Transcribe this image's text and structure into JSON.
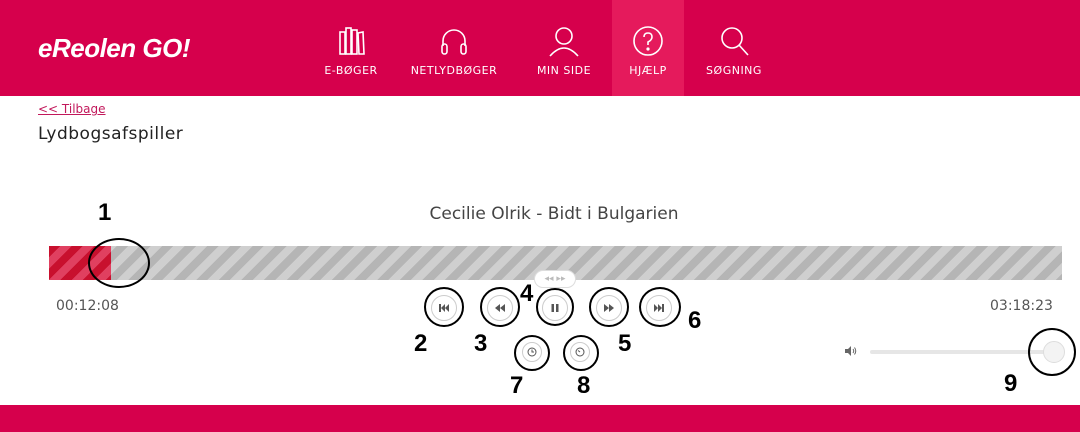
{
  "header": {
    "logo": "eReolen GO!",
    "nav": [
      {
        "label": "E-BØGER",
        "icon": "books-icon"
      },
      {
        "label": "NETLYDBØGER",
        "icon": "headphones-icon"
      },
      {
        "label": "MIN SIDE",
        "icon": "user-icon"
      },
      {
        "label": "HJÆLP",
        "icon": "help-icon"
      },
      {
        "label": "SØGNING",
        "icon": "search-icon"
      }
    ]
  },
  "back_link": "<< Tilbage",
  "page_title": "Lydbogsafspiller",
  "player": {
    "track_title": "Cecilie Olrik - Bidt i Bulgarien",
    "time_elapsed": "00:12:08",
    "time_total": "03:18:23",
    "progress": 0.061,
    "volume": 1.0
  },
  "annotations": [
    "1",
    "2",
    "3",
    "4",
    "5",
    "6",
    "7",
    "8",
    "9"
  ],
  "colors": {
    "brand": "#d6004c",
    "progress": "#c8102e"
  }
}
